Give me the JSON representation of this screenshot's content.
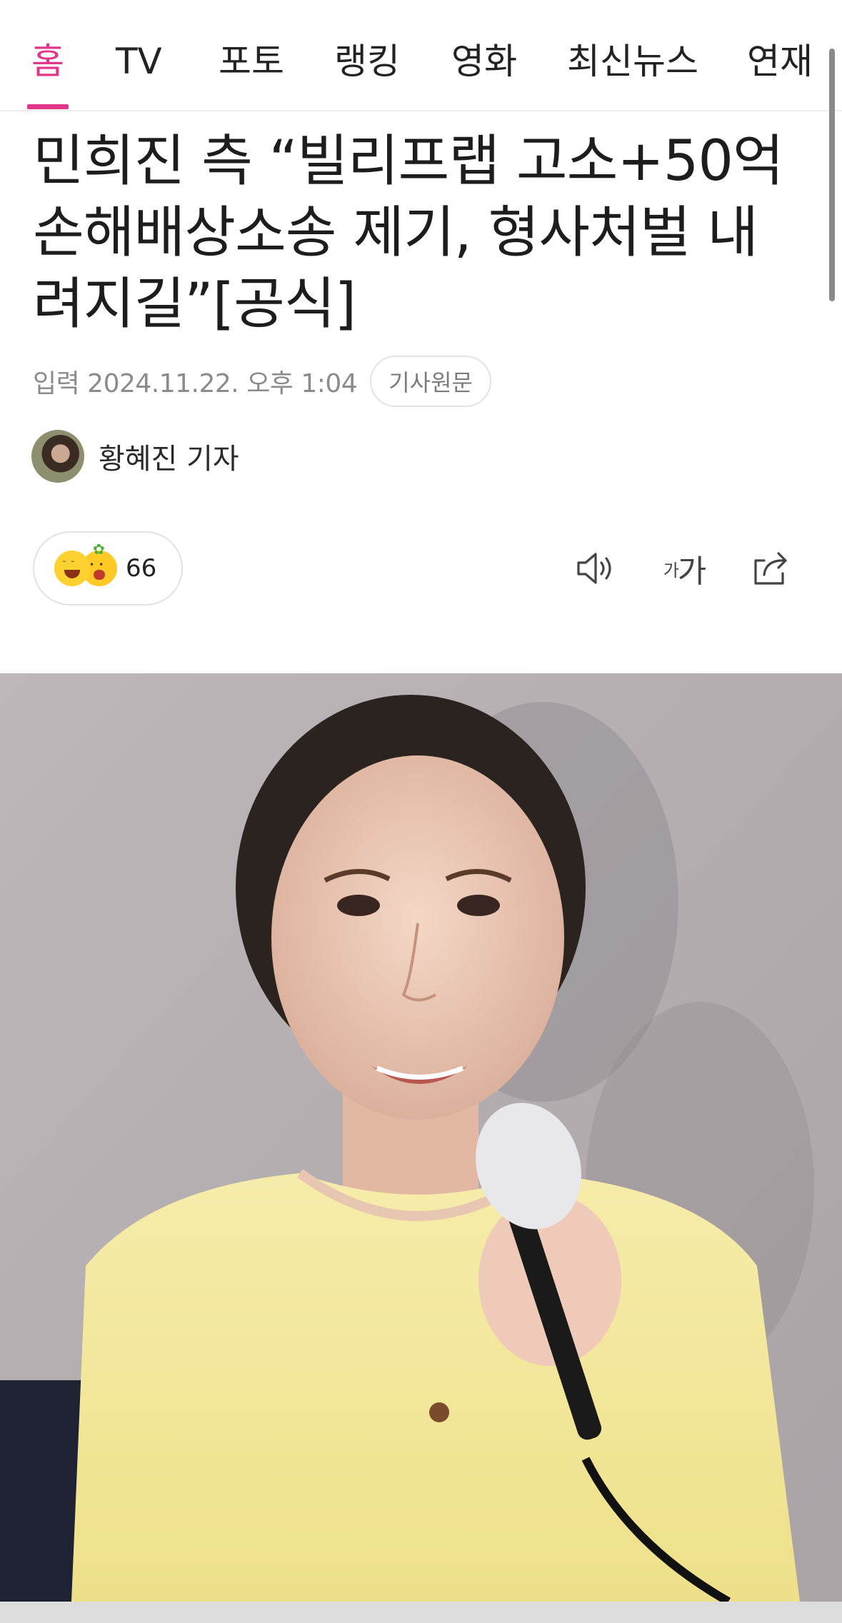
{
  "nav": {
    "tabs": [
      {
        "label": "홈",
        "active": true
      },
      {
        "label": "TV",
        "active": false
      },
      {
        "label": "포토",
        "active": false
      },
      {
        "label": "랭킹",
        "active": false
      },
      {
        "label": "영화",
        "active": false
      },
      {
        "label": "최신뉴스",
        "active": false
      },
      {
        "label": "연재",
        "active": false
      }
    ]
  },
  "article": {
    "headline": "민희진 측 “빌리프랩 고소+50억 손해배상소송 제기, 형사처벌 내려지길”[공식]",
    "date": "입력 2024.11.22. 오후 1:04",
    "source_button": "기사원문",
    "reporter": "황혜진 기자"
  },
  "reactions": {
    "count": "66"
  },
  "toolbar": {
    "font_small": "가",
    "font_large": "가"
  },
  "colors": {
    "accent": "#e0378c",
    "muted_text": "#8b8b8b"
  },
  "icons": [
    "speaker-icon",
    "font-size-icon",
    "share-icon",
    "laugh-emoji-icon",
    "surprise-emoji-icon"
  ]
}
